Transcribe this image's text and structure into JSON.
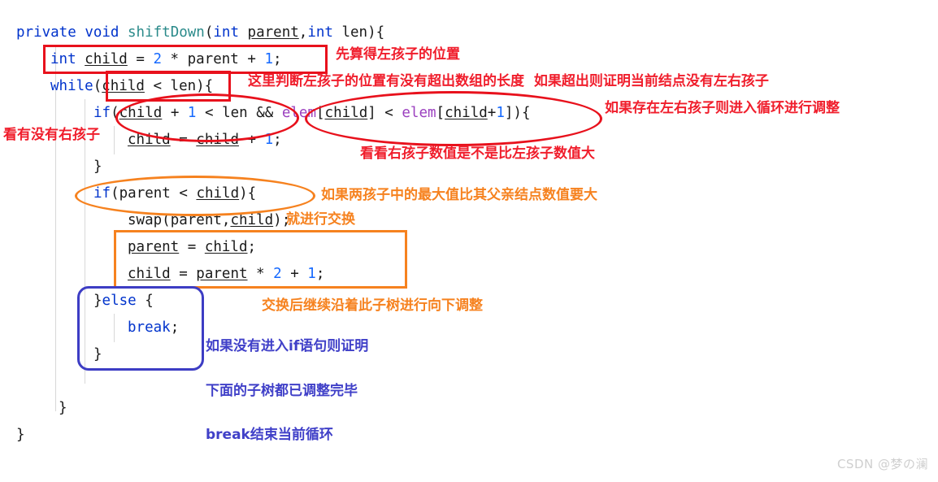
{
  "document": {
    "language": "Java",
    "method_name": "shiftDown",
    "background_color": "#ffffff"
  },
  "code": {
    "lines": [
      {
        "id": "line-signature",
        "indent": 0,
        "tokens": [
          {
            "t": "private",
            "c": "kw"
          },
          {
            "t": " ",
            "c": "plain"
          },
          {
            "t": "void",
            "c": "kw"
          },
          {
            "t": " ",
            "c": "plain"
          },
          {
            "t": "shiftDown",
            "c": "fn"
          },
          {
            "t": "(",
            "c": "plain"
          },
          {
            "t": "int",
            "c": "kw"
          },
          {
            "t": " ",
            "c": "plain"
          },
          {
            "t": "parent",
            "c": "var"
          },
          {
            "t": ",",
            "c": "plain"
          },
          {
            "t": "int",
            "c": "kw"
          },
          {
            "t": " ",
            "c": "plain"
          },
          {
            "t": "len",
            "c": "plain"
          },
          {
            "t": "){",
            "c": "plain"
          }
        ]
      },
      {
        "id": "line-declare-child",
        "indent": 1,
        "tokens": [
          {
            "t": "int",
            "c": "kw"
          },
          {
            "t": " ",
            "c": "plain"
          },
          {
            "t": "child",
            "c": "var"
          },
          {
            "t": " = ",
            "c": "plain"
          },
          {
            "t": "2",
            "c": "num"
          },
          {
            "t": " * ",
            "c": "plain"
          },
          {
            "t": "parent",
            "c": "plain"
          },
          {
            "t": " + ",
            "c": "plain"
          },
          {
            "t": "1",
            "c": "num"
          },
          {
            "t": ";",
            "c": "plain"
          }
        ]
      },
      {
        "id": "line-while",
        "indent": 1,
        "tokens": [
          {
            "t": "while",
            "c": "kw"
          },
          {
            "t": "(",
            "c": "plain"
          },
          {
            "t": "child",
            "c": "var"
          },
          {
            "t": " < ",
            "c": "plain"
          },
          {
            "t": "len",
            "c": "plain"
          },
          {
            "t": "){",
            "c": "plain"
          }
        ]
      },
      {
        "id": "line-if-right-child",
        "indent": 2,
        "tokens": [
          {
            "t": "if",
            "c": "kw"
          },
          {
            "t": "(",
            "c": "plain"
          },
          {
            "t": "child",
            "c": "var"
          },
          {
            "t": " + ",
            "c": "plain"
          },
          {
            "t": "1",
            "c": "num"
          },
          {
            "t": " < ",
            "c": "plain"
          },
          {
            "t": "len",
            "c": "plain"
          },
          {
            "t": " && ",
            "c": "plain"
          },
          {
            "t": "elem",
            "c": "fld"
          },
          {
            "t": "[",
            "c": "plain"
          },
          {
            "t": "child",
            "c": "var"
          },
          {
            "t": "] < ",
            "c": "plain"
          },
          {
            "t": "elem",
            "c": "fld"
          },
          {
            "t": "[",
            "c": "plain"
          },
          {
            "t": "child",
            "c": "var"
          },
          {
            "t": "+",
            "c": "plain"
          },
          {
            "t": "1",
            "c": "num"
          },
          {
            "t": "]){",
            "c": "plain"
          }
        ]
      },
      {
        "id": "line-child-plus-one",
        "indent": 3,
        "tokens": [
          {
            "t": "child",
            "c": "var"
          },
          {
            "t": " = ",
            "c": "plain"
          },
          {
            "t": "child",
            "c": "var"
          },
          {
            "t": " + ",
            "c": "plain"
          },
          {
            "t": "1",
            "c": "num"
          },
          {
            "t": ";",
            "c": "plain"
          }
        ]
      },
      {
        "id": "line-close-if-right",
        "indent": 2,
        "tokens": [
          {
            "t": "}",
            "c": "plain"
          }
        ]
      },
      {
        "id": "line-if-parent-less-child",
        "indent": 2,
        "tokens": [
          {
            "t": "if",
            "c": "kw"
          },
          {
            "t": "(",
            "c": "plain"
          },
          {
            "t": "parent",
            "c": "plain"
          },
          {
            "t": " < ",
            "c": "plain"
          },
          {
            "t": "child",
            "c": "var"
          },
          {
            "t": "){",
            "c": "plain"
          }
        ]
      },
      {
        "id": "line-swap",
        "indent": 3,
        "tokens": [
          {
            "t": "swap",
            "c": "plain"
          },
          {
            "t": "(",
            "c": "plain"
          },
          {
            "t": "parent",
            "c": "plain"
          },
          {
            "t": ",",
            "c": "plain"
          },
          {
            "t": "child",
            "c": "var"
          },
          {
            "t": ");",
            "c": "plain"
          }
        ]
      },
      {
        "id": "line-parent-eq-child",
        "indent": 3,
        "tokens": [
          {
            "t": "parent",
            "c": "var"
          },
          {
            "t": " = ",
            "c": "plain"
          },
          {
            "t": "child",
            "c": "var"
          },
          {
            "t": ";",
            "c": "plain"
          }
        ]
      },
      {
        "id": "line-child-eq-parent",
        "indent": 3,
        "tokens": [
          {
            "t": "child",
            "c": "var"
          },
          {
            "t": " = ",
            "c": "plain"
          },
          {
            "t": "parent",
            "c": "var"
          },
          {
            "t": " * ",
            "c": "plain"
          },
          {
            "t": "2",
            "c": "num"
          },
          {
            "t": " + ",
            "c": "plain"
          },
          {
            "t": "1",
            "c": "num"
          },
          {
            "t": ";",
            "c": "plain"
          }
        ]
      },
      {
        "id": "line-else",
        "indent": 2,
        "tokens": [
          {
            "t": "}",
            "c": "plain"
          },
          {
            "t": "else",
            "c": "kw"
          },
          {
            "t": " {",
            "c": "plain"
          }
        ]
      },
      {
        "id": "line-break",
        "indent": 3,
        "tokens": [
          {
            "t": "break",
            "c": "kw"
          },
          {
            "t": ";",
            "c": "plain"
          }
        ]
      },
      {
        "id": "line-close-else",
        "indent": 2,
        "tokens": [
          {
            "t": "}",
            "c": "plain"
          }
        ]
      },
      {
        "id": "line-close-while",
        "indent": 1,
        "tokens": [
          {
            "t": "}",
            "c": "plain"
          }
        ]
      },
      {
        "id": "line-close-method",
        "indent": 0,
        "tokens": [
          {
            "t": "}",
            "c": "plain"
          }
        ]
      }
    ]
  },
  "annotations": [
    {
      "id": "anno-left-child-position",
      "text": "先算得左孩子的位置",
      "color": "red"
    },
    {
      "id": "anno-check-bounds",
      "text": "这里判断左孩子的位置有没有超出数组的长度  如果超出则证明当前结点没有左右孩子",
      "color": "red"
    },
    {
      "id": "anno-enter-loop",
      "text": "如果存在左右孩子则进入循环进行调整",
      "color": "red"
    },
    {
      "id": "anno-has-right-child",
      "text": "看有没有右孩子",
      "color": "red"
    },
    {
      "id": "anno-compare-children",
      "text": "看看右孩子数值是不是比左孩子数值大",
      "color": "red"
    },
    {
      "id": "anno-max-child-gt-parent",
      "text": "如果两孩子中的最大值比其父亲结点数值要大",
      "color": "orange"
    },
    {
      "id": "anno-do-swap",
      "text": "就进行交换",
      "color": "orange"
    },
    {
      "id": "anno-continue-down",
      "text": "交换后继续沿着此子树进行向下调整",
      "color": "orange"
    },
    {
      "id": "anno-no-if-entered",
      "text": "如果没有进入if语句则证明",
      "color": "blue"
    },
    {
      "id": "anno-subtree-done",
      "text": "下面的子树都已调整完毕",
      "color": "blue"
    },
    {
      "id": "anno-break-loop",
      "text": "break结束当前循环",
      "color": "blue"
    }
  ],
  "shapes": {
    "red_box_child_decl": "rectangle",
    "red_box_while_cond": "rectangle",
    "red_oval_right_child_cond": "ellipse",
    "red_oval_elem_compare": "ellipse",
    "orange_oval_parent_child": "ellipse",
    "orange_box_update": "rectangle",
    "blue_box_else": "rounded-rectangle"
  },
  "colors": {
    "red": "#e8111c",
    "orange": "#f6821f",
    "blue": "#3d3dc4",
    "keyword": "#0033cc",
    "method": "#2a8a8a",
    "number": "#1569ff",
    "field": "#9b3fbf",
    "text": "#1a1a1a"
  },
  "watermark": {
    "text": "CSDN @梦の澜"
  }
}
